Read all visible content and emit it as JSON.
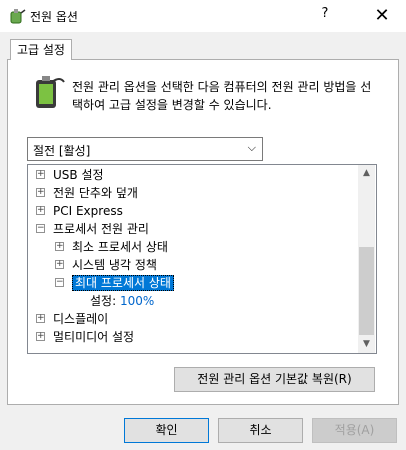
{
  "window": {
    "title": "전원 옵션",
    "help": "?",
    "close": "✕"
  },
  "tab": {
    "label": "고급 설정"
  },
  "description": "전원 관리 옵션을 선택한 다음 컴퓨터의 전원 관리 방법을 선택하여 고급 설정을 변경할 수 있습니다.",
  "plan_select": {
    "value": "절전 [활성]",
    "arrow": "⌵"
  },
  "tree": {
    "items": [
      {
        "expander": "+",
        "label": "USB 설정"
      },
      {
        "expander": "+",
        "label": "전원 단추와 덮개"
      },
      {
        "expander": "+",
        "label": "PCI Express"
      },
      {
        "expander": "−",
        "label": "프로세서 전원 관리"
      },
      {
        "expander": "+",
        "label": "최소 프로세서 상태"
      },
      {
        "expander": "+",
        "label": "시스템 냉각 정책"
      },
      {
        "expander": "−",
        "label": "최대 프로세서 상태"
      },
      {
        "setting_label": "설정:",
        "setting_value": "100%"
      },
      {
        "expander": "+",
        "label": "디스플레이"
      },
      {
        "expander": "+",
        "label": "멀티미디어 설정"
      }
    ]
  },
  "scrollbar": {
    "up": "▲",
    "down": "▼"
  },
  "buttons": {
    "restore": "전원 관리 옵션 기본값 복원(R)",
    "ok": "확인",
    "cancel": "취소",
    "apply": "적용(A)"
  },
  "colors": {
    "selection": "#0078d7",
    "link_value": "#0066cc"
  }
}
